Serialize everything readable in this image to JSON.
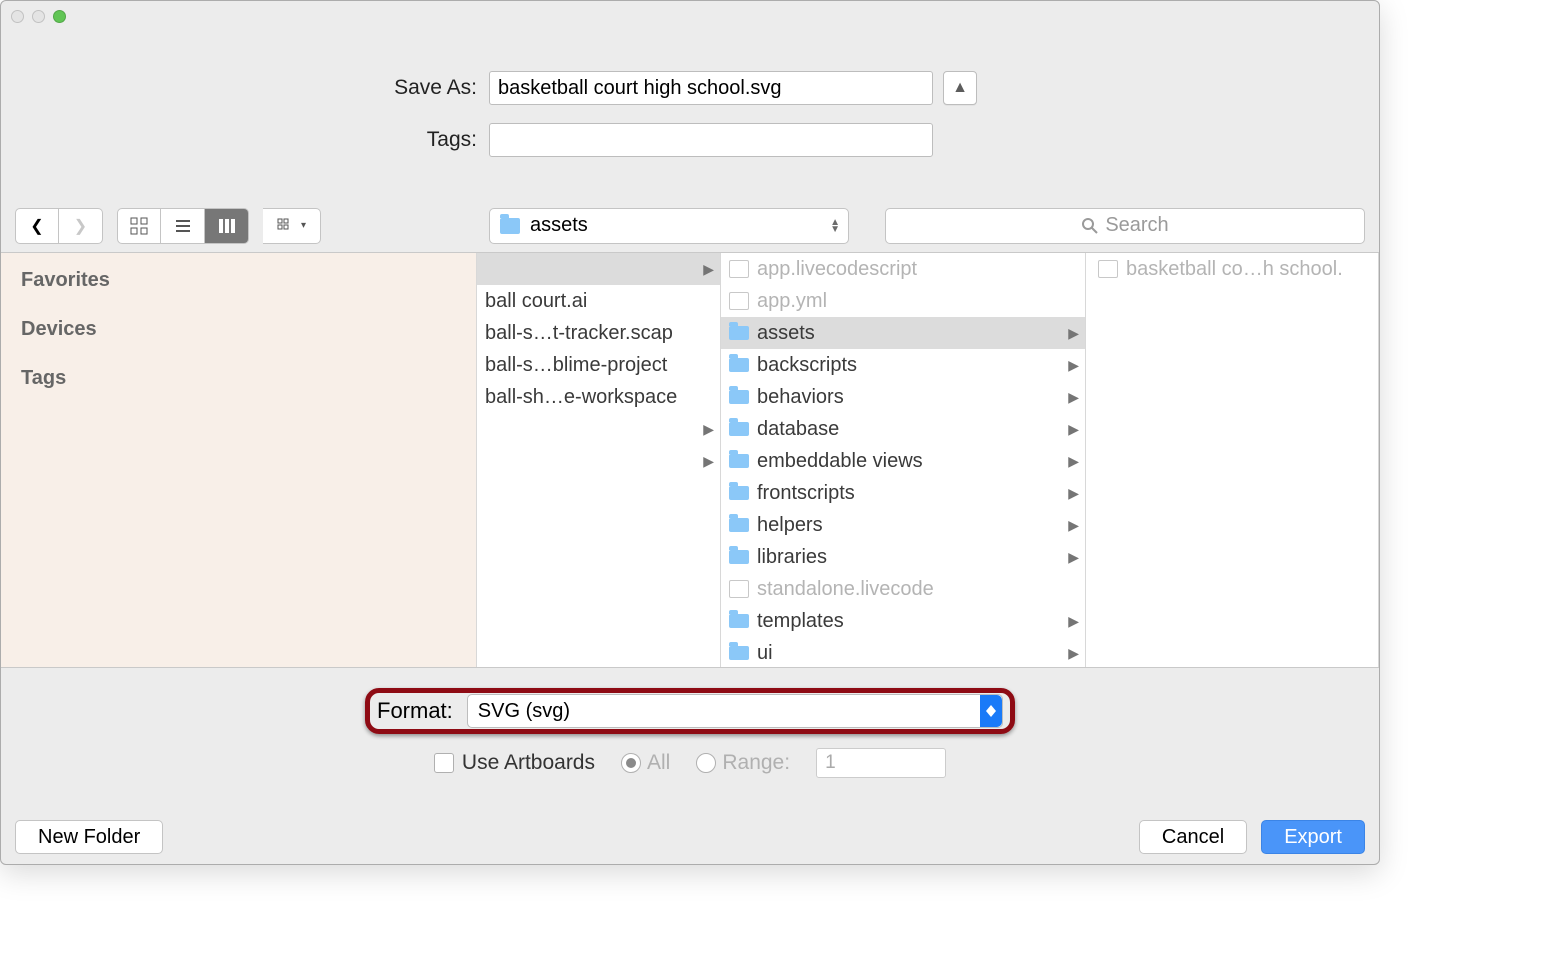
{
  "saveAs": {
    "label": "Save As:",
    "value": "basketball court high school.svg"
  },
  "tags": {
    "label": "Tags:",
    "value": ""
  },
  "path": {
    "folderName": "assets"
  },
  "search": {
    "placeholder": "Search"
  },
  "sidebar": {
    "items": [
      "Favorites",
      "Devices",
      "Tags"
    ]
  },
  "col1": {
    "items": [
      {
        "label": "",
        "arrow": true,
        "selected": true
      },
      {
        "label": "ball court.ai"
      },
      {
        "label": "ball-s…t-tracker.scap"
      },
      {
        "label": "ball-s…blime-project"
      },
      {
        "label": "ball-sh…e-workspace"
      },
      {
        "label": "",
        "arrow": true
      },
      {
        "label": "",
        "arrow": true
      }
    ]
  },
  "col2": {
    "items": [
      {
        "label": "app.livecodescript",
        "type": "file",
        "dim": true
      },
      {
        "label": "app.yml",
        "type": "file",
        "dim": true
      },
      {
        "label": "assets",
        "type": "folder",
        "arrow": true,
        "selected": true
      },
      {
        "label": "backscripts",
        "type": "folder",
        "arrow": true
      },
      {
        "label": "behaviors",
        "type": "folder",
        "arrow": true
      },
      {
        "label": "database",
        "type": "folder",
        "arrow": true
      },
      {
        "label": "embeddable views",
        "type": "folder",
        "arrow": true
      },
      {
        "label": "frontscripts",
        "type": "folder",
        "arrow": true
      },
      {
        "label": "helpers",
        "type": "folder",
        "arrow": true
      },
      {
        "label": "libraries",
        "type": "folder",
        "arrow": true
      },
      {
        "label": "standalone.livecode",
        "type": "file",
        "dim": true
      },
      {
        "label": "templates",
        "type": "folder",
        "arrow": true
      },
      {
        "label": "ui",
        "type": "folder",
        "arrow": true
      }
    ]
  },
  "col3": {
    "items": [
      {
        "label": "basketball co…h school.",
        "type": "file",
        "dim": true
      }
    ]
  },
  "format": {
    "label": "Format:",
    "value": "SVG (svg)"
  },
  "exportOptions": {
    "useArtboards": {
      "label": "Use Artboards",
      "checked": false
    },
    "all": {
      "label": "All"
    },
    "range": {
      "label": "Range:",
      "value": "1"
    }
  },
  "buttons": {
    "newFolder": "New Folder",
    "cancel": "Cancel",
    "export": "Export"
  }
}
